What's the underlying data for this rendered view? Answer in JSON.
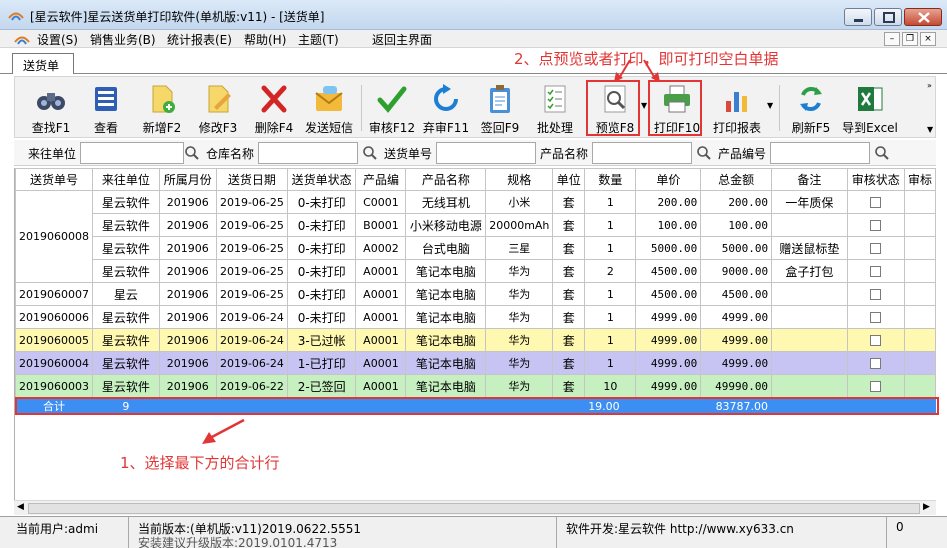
{
  "window": {
    "title": "[星云软件]星云送货单打印软件(单机版:v11) - [送货单]"
  },
  "menu": {
    "items": [
      "设置(S)",
      "销售业务(B)",
      "统计报表(E)",
      "帮助(H)",
      "主题(T)",
      "返回主界面"
    ]
  },
  "tab": {
    "label": "送货单"
  },
  "toolbar": {
    "items": [
      "查找F1",
      "查看",
      "新增F2",
      "修改F3",
      "删除F4",
      "发送短信",
      "审核F12",
      "弃审F11",
      "签回F9",
      "批处理",
      "预览F8",
      "打印F10",
      "打印报表",
      "刷新F5",
      "导到Excel"
    ]
  },
  "search": {
    "label1": "来往单位",
    "label2": "仓库名称",
    "label3": "送货单号",
    "label4": "产品名称",
    "label5": "产品编号"
  },
  "table": {
    "headers": [
      "送货单号",
      "来往单位",
      "所属月份",
      "送货日期",
      "送货单状态",
      "产品编",
      "产品名称",
      "规格",
      "单位",
      "数量",
      "单价",
      "总金额",
      "备注",
      "审核状态",
      "审标"
    ],
    "rows": [
      {
        "no": "2019060008",
        "unit": "星云软件",
        "month": "201906",
        "date": "2019-06-25",
        "status": "0-未打印",
        "code": "C0001",
        "name": "无线耳机",
        "spec": "小米",
        "uom": "套",
        "qty": "1",
        "price": "200.00",
        "amount": "200.00",
        "note": "一年质保"
      },
      {
        "no": "",
        "unit": "星云软件",
        "month": "201906",
        "date": "2019-06-25",
        "status": "0-未打印",
        "code": "B0001",
        "name": "小米移动电源",
        "spec": "20000mAh",
        "uom": "套",
        "qty": "1",
        "price": "100.00",
        "amount": "100.00",
        "note": ""
      },
      {
        "no": "",
        "unit": "星云软件",
        "month": "201906",
        "date": "2019-06-25",
        "status": "0-未打印",
        "code": "A0002",
        "name": "台式电脑",
        "spec": "三星",
        "uom": "套",
        "qty": "1",
        "price": "5000.00",
        "amount": "5000.00",
        "note": "赠送鼠标垫"
      },
      {
        "no": "",
        "unit": "星云软件",
        "month": "201906",
        "date": "2019-06-25",
        "status": "0-未打印",
        "code": "A0001",
        "name": "笔记本电脑",
        "spec": "华为",
        "uom": "套",
        "qty": "2",
        "price": "4500.00",
        "amount": "9000.00",
        "note": "盒子打包"
      },
      {
        "no": "2019060007",
        "unit": "星云",
        "month": "201906",
        "date": "2019-06-25",
        "status": "0-未打印",
        "code": "A0001",
        "name": "笔记本电脑",
        "spec": "华为",
        "uom": "套",
        "qty": "1",
        "price": "4500.00",
        "amount": "4500.00",
        "note": ""
      },
      {
        "no": "2019060006",
        "unit": "星云软件",
        "month": "201906",
        "date": "2019-06-24",
        "status": "0-未打印",
        "code": "A0001",
        "name": "笔记本电脑",
        "spec": "华为",
        "uom": "套",
        "qty": "1",
        "price": "4999.00",
        "amount": "4999.00",
        "note": ""
      },
      {
        "no": "2019060005",
        "unit": "星云软件",
        "month": "201906",
        "date": "2019-06-24",
        "status": "3-已过帐",
        "code": "A0001",
        "name": "笔记本电脑",
        "spec": "华为",
        "uom": "套",
        "qty": "1",
        "price": "4999.00",
        "amount": "4999.00",
        "note": ""
      },
      {
        "no": "2019060004",
        "unit": "星云软件",
        "month": "201906",
        "date": "2019-06-24",
        "status": "1-已打印",
        "code": "A0001",
        "name": "笔记本电脑",
        "spec": "华为",
        "uom": "套",
        "qty": "1",
        "price": "4999.00",
        "amount": "4999.00",
        "note": ""
      },
      {
        "no": "2019060003",
        "unit": "星云软件",
        "month": "201906",
        "date": "2019-06-22",
        "status": "2-已签回",
        "code": "A0001",
        "name": "笔记本电脑",
        "spec": "华为",
        "uom": "套",
        "qty": "10",
        "price": "4999.00",
        "amount": "49990.00",
        "note": ""
      }
    ],
    "total": {
      "label": "合计",
      "count": "9",
      "qty": "19.00",
      "amount": "83787.00"
    }
  },
  "annotations": {
    "step1": "1、选择最下方的合计行",
    "step2": "2、点预览或者打印，即可打印空白单据"
  },
  "status": {
    "user": "当前用户:admi",
    "version": "当前版本:(单机版:v11)2019.0622.5551",
    "version2": "安装建议升级版本:2019.0101.4713",
    "developer": "软件开发:星云软件 http://www.xy633.cn",
    "count": "0"
  },
  "colors": {
    "highlight_red": "#e23636",
    "total_row_blue": "#3d8ef2",
    "row_yellow": "#fff8b0",
    "row_purple": "#c7c3f3",
    "row_green": "#c6f0bf"
  }
}
